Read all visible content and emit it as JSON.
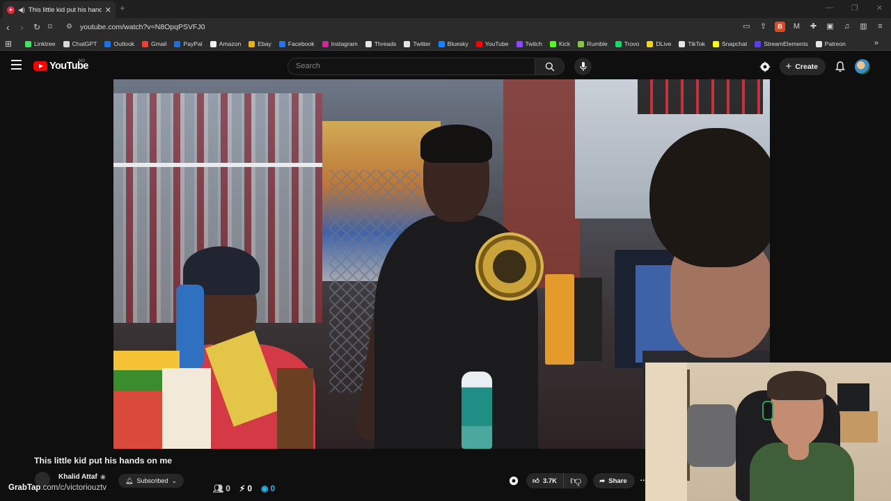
{
  "browser": {
    "tab_title": "This little kid put his hands on me",
    "url": "youtube.com/watch?v=N8OpqPSVFJ0",
    "bookmarks": [
      {
        "label": "Linktree",
        "color": "#43e55e"
      },
      {
        "label": "ChatGPT",
        "color": "#d9d9d9"
      },
      {
        "label": "Outlook",
        "color": "#1a73e8"
      },
      {
        "label": "Gmail",
        "color": "#ea4335"
      },
      {
        "label": "PayPal",
        "color": "#1f6fd6"
      },
      {
        "label": "Amazon",
        "color": "#f2f2f2"
      },
      {
        "label": "Ebay",
        "color": "#f5af02"
      },
      {
        "label": "Facebook",
        "color": "#1877f2"
      },
      {
        "label": "Instagram",
        "color": "#d6249f"
      },
      {
        "label": "Threads",
        "color": "#e5e5e5"
      },
      {
        "label": "Twitter",
        "color": "#e5e5e5"
      },
      {
        "label": "Bluesky",
        "color": "#1185fe"
      },
      {
        "label": "YouTube",
        "color": "#ff0000"
      },
      {
        "label": "Twitch",
        "color": "#9146ff"
      },
      {
        "label": "Kick",
        "color": "#53fc18"
      },
      {
        "label": "Rumble",
        "color": "#85c742"
      },
      {
        "label": "Trovo",
        "color": "#19d66b"
      },
      {
        "label": "DLive",
        "color": "#ffd300"
      },
      {
        "label": "TikTok",
        "color": "#e5e5e5"
      },
      {
        "label": "Snapchat",
        "color": "#fffc00"
      },
      {
        "label": "StreamElements",
        "color": "#5b3cf5"
      },
      {
        "label": "Patreon",
        "color": "#e5e5e5"
      }
    ]
  },
  "masthead": {
    "logo_text": "YouTube",
    "country_code": "NO",
    "search_placeholder": "Search",
    "create_label": "Create"
  },
  "video": {
    "title": "This little kid put his hands on me",
    "channel_name": "Khalid Attaf",
    "subscribe_label": "Subscribed",
    "likes": "3.7K",
    "share_label": "Share"
  },
  "overlay": {
    "watermark_brand": "GrabTap",
    "watermark_text": ".com/c/victoriouztv",
    "stat_viewers": "0",
    "stat_bolt": "0",
    "stat_blue": "0"
  },
  "colors": {
    "yt_red": "#ff0000",
    "page_bg": "#0f0f0f",
    "stat_blue": "#2ab5e8"
  }
}
